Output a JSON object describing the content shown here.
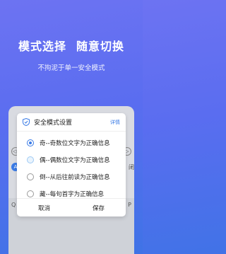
{
  "headline": {
    "part1": "模式选择",
    "part2": "随意切换"
  },
  "subline": "不拘泥于单一安全模式",
  "background_keys": {
    "left_top": "◁)",
    "left_mid": "A",
    "right_top": "▷",
    "right_mid": "闭",
    "left_bottom": "Q",
    "right_bottom": "P"
  },
  "dialog": {
    "title": "安全模式设置",
    "detail_link": "详情",
    "options": [
      {
        "label": "奇--奇数位文字为正确信息",
        "state": "checked"
      },
      {
        "label": "偶--偶数位文字为正确信息",
        "state": "hover"
      },
      {
        "label": "倒--从后往前读为正确信息",
        "state": "unchecked"
      },
      {
        "label": "藏--每句首字为正确信息",
        "state": "unchecked"
      }
    ],
    "cancel_label": "取消",
    "save_label": "保存"
  },
  "colors": {
    "accent": "#3a7be6",
    "bg_top": "#6d73f2",
    "bg_bottom": "#3f73e6"
  }
}
